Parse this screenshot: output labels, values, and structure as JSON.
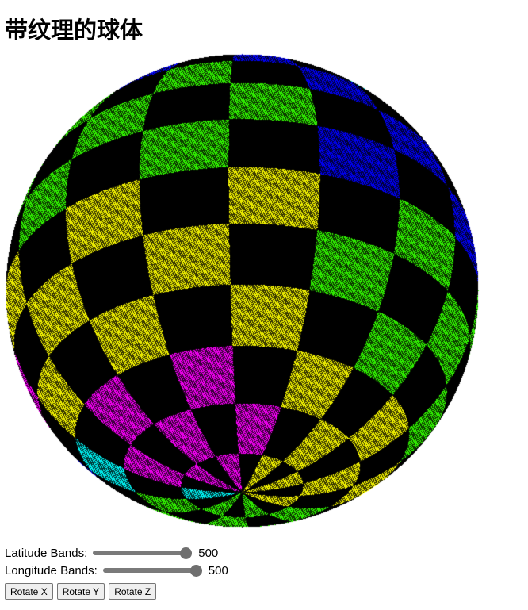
{
  "page": {
    "title": "带纹理的球体"
  },
  "controls": {
    "latitude": {
      "label": "Latitude Bands:",
      "value": "500"
    },
    "longitude": {
      "label": "Longitude Bands:",
      "value": "500"
    },
    "buttons": {
      "rotate_x": "Rotate X",
      "rotate_y": "Rotate Y",
      "rotate_z": "Rotate Z"
    }
  },
  "colors": {
    "magenta": "#ff00ff",
    "cyan": "#00ffff",
    "blue": "#0000ff",
    "green": "#33ff00",
    "yellow": "#ffff00",
    "black": "#000000"
  }
}
